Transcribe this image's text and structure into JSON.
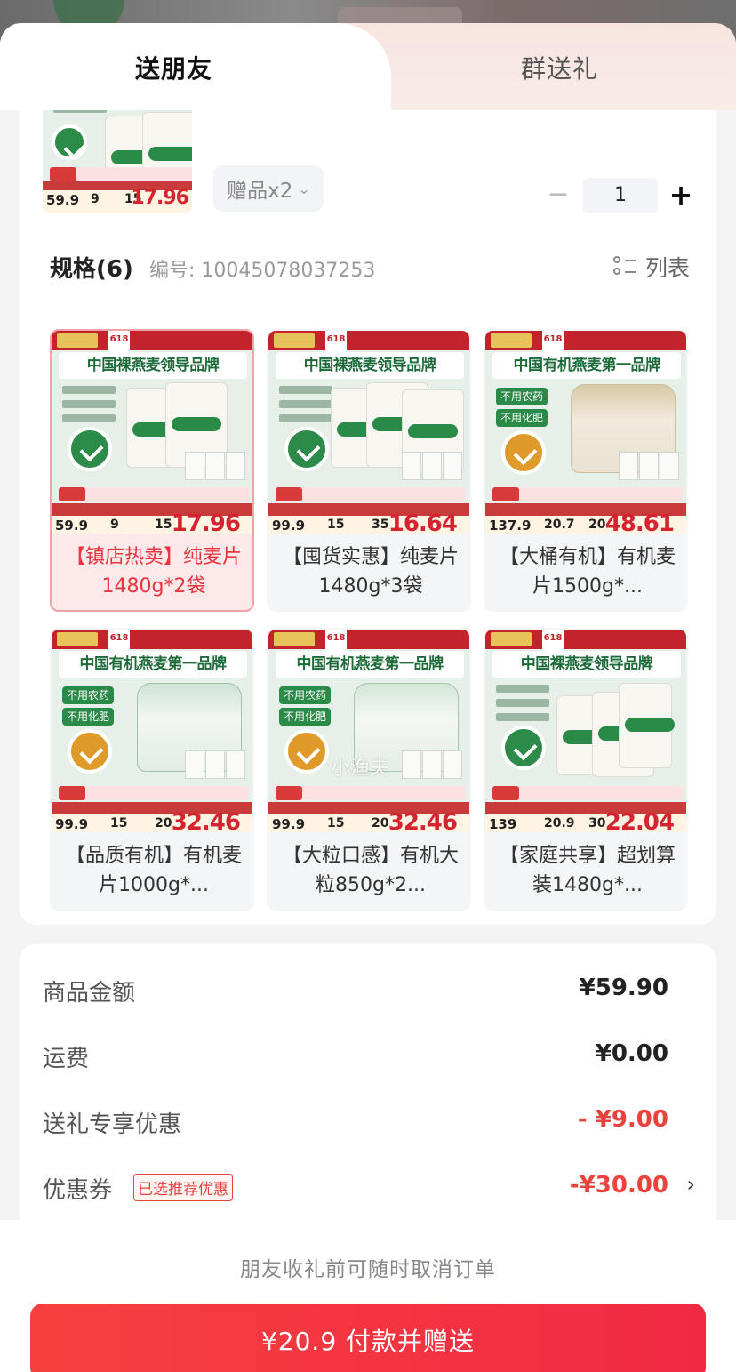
{
  "tabs": {
    "friend": "送朋友",
    "group": "群送礼"
  },
  "gift": {
    "pill_label": "赠品x2"
  },
  "quantity": {
    "value": "1",
    "minus": "−",
    "plus": "+"
  },
  "spec": {
    "title": "规格(6)",
    "code": "编号: 10045078037253",
    "list_label": "列表"
  },
  "items": [
    {
      "name": "【镇店热卖】纯麦片1480g*2袋",
      "headline": "中国裸燕麦领导品牌",
      "price_left": "59.9",
      "price_mid": "9",
      "price_n": "15",
      "price_final": "17.96",
      "selected": true,
      "style": "bags"
    },
    {
      "name": "【囤货实惠】纯麦片1480g*3袋",
      "headline": "中国裸燕麦领导品牌",
      "price_left": "99.9",
      "price_mid": "15",
      "price_n": "35",
      "price_final": "16.64",
      "selected": false,
      "style": "bags"
    },
    {
      "name": "【大桶有机】有机麦片1500g*...",
      "headline": "中国有机燕麦第一品牌",
      "price_left": "137.9",
      "price_mid": "20.7",
      "price_n": "20",
      "price_final": "48.61",
      "selected": false,
      "style": "jar"
    },
    {
      "name": "【品质有机】有机麦片1000g*...",
      "headline": "中国有机燕麦第一品牌",
      "price_left": "99.9",
      "price_mid": "15",
      "price_n": "20",
      "price_final": "32.46",
      "selected": false,
      "style": "jar"
    },
    {
      "name": "【大粒口感】有机大粒850g*2...",
      "headline": "中国有机燕麦第一品牌",
      "price_left": "99.9",
      "price_mid": "15",
      "price_n": "20",
      "price_final": "32.46",
      "selected": false,
      "style": "jar"
    },
    {
      "name": "【家庭共享】超划算装1480g*...",
      "headline": "中国裸燕麦领导品牌",
      "price_left": "139",
      "price_mid": "20.9",
      "price_n": "30",
      "price_final": "22.04",
      "selected": false,
      "style": "bags"
    }
  ],
  "thumb": {
    "price_left": "59.9",
    "price_mid": "9",
    "price_n": "15",
    "price_final": "17.96"
  },
  "watermark": "小渔夫",
  "summary": {
    "goods_label": "商品金额",
    "goods_value": "¥59.90",
    "shipping_label": "运费",
    "shipping_value": "¥0.00",
    "gift_discount_label": "送礼专享优惠",
    "gift_discount_value": "- ¥9.00",
    "coupon_label": "优惠券",
    "coupon_tag": "已选推荐优惠",
    "coupon_value": "-¥30.00"
  },
  "footer": {
    "note": "朋友收礼前可随时取消订单",
    "pay_button": "¥20.9 付款并赠送"
  },
  "colors": {
    "accent": "#f02a43",
    "discount": "#e8433d",
    "selected_bg": "#fde8ea"
  }
}
